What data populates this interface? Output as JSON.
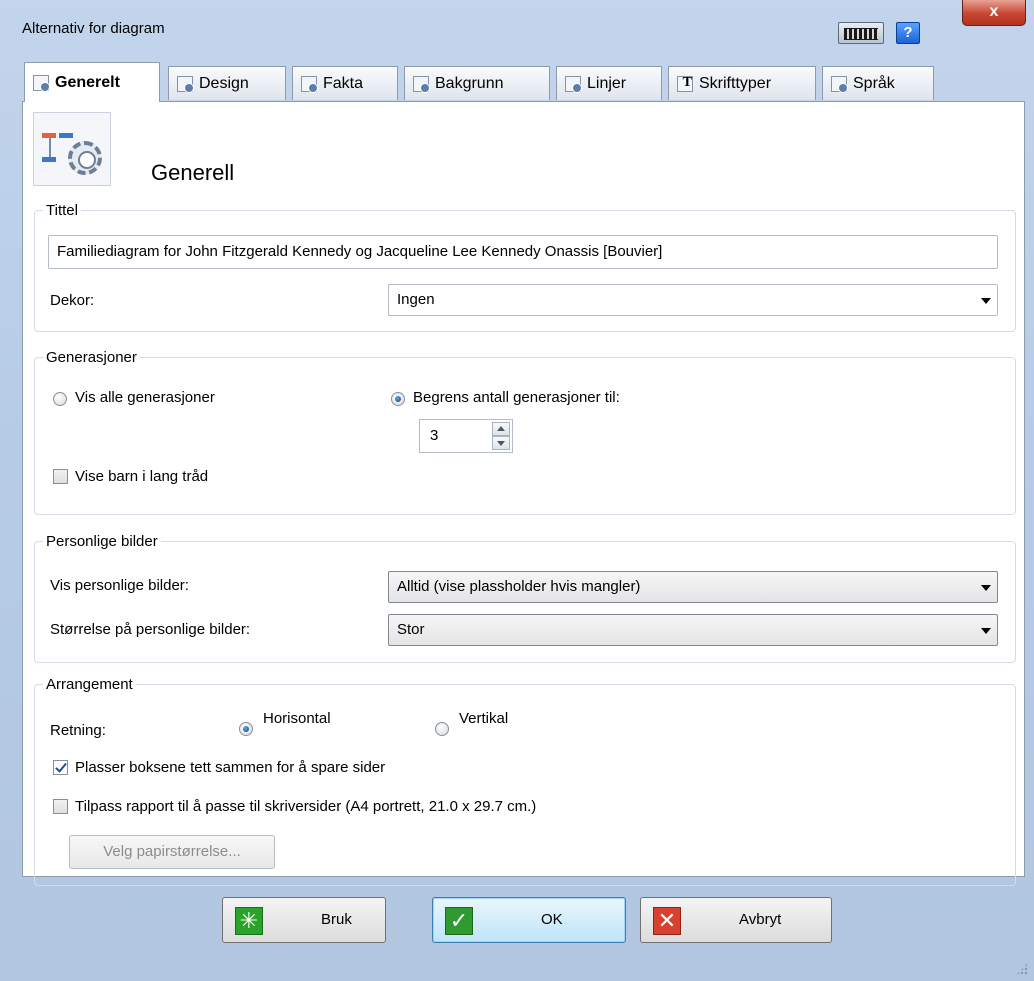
{
  "window": {
    "title": "Alternativ for diagram",
    "help_label": "?",
    "close_label": "x"
  },
  "tabs": [
    {
      "label": "Generelt",
      "active": true,
      "icon": "general-settings-icon"
    },
    {
      "label": "Design",
      "active": false,
      "icon": "design-preview-icon"
    },
    {
      "label": "Fakta",
      "active": false,
      "icon": "facts-icon"
    },
    {
      "label": "Bakgrunn",
      "active": false,
      "icon": "background-icon"
    },
    {
      "label": "Linjer",
      "active": false,
      "icon": "lines-icon"
    },
    {
      "label": "Skrifttyper",
      "active": false,
      "icon": "fonts-icon"
    },
    {
      "label": "Språk",
      "active": false,
      "icon": "language-icon"
    }
  ],
  "header": {
    "title": "Generell"
  },
  "tittel": {
    "legend": "Tittel",
    "value": "Familiediagram for John Fitzgerald Kennedy og Jacqueline Lee Kennedy Onassis [Bouvier]",
    "dekor_label": "Dekor:",
    "dekor_value": "Ingen"
  },
  "generasjoner": {
    "legend": "Generasjoner",
    "all_label": "Vis alle generasjoner",
    "all_selected": false,
    "limit_label": "Begrens antall generasjoner til:",
    "limit_selected": true,
    "limit_value": "3",
    "long_thread_label": "Vise barn i lang tråd",
    "long_thread_checked": false
  },
  "bilder": {
    "legend": "Personlige bilder",
    "show_label": "Vis personlige bilder:",
    "show_value": "Alltid (vise plassholder hvis mangler)",
    "size_label": "Størrelse på personlige bilder:",
    "size_value": "Stor"
  },
  "arrangement": {
    "legend": "Arrangement",
    "direction_label": "Retning:",
    "horizontal_label": "Horisontal",
    "horizontal_selected": true,
    "vertical_label": "Vertikal",
    "vertical_selected": false,
    "compact_label": "Plasser boksene tett sammen for å spare sider",
    "compact_checked": true,
    "fit_label": "Tilpass rapport til å passe til skriversider (A4 portrett, 21.0 x 29.7 cm.)",
    "fit_checked": false,
    "paper_button": "Velg papirstørrelse..."
  },
  "footer": {
    "apply": "Bruk",
    "ok": "OK",
    "cancel": "Avbryt"
  },
  "colors": {
    "window_frame": "#b6cbe6",
    "apply_icon": "#29a329",
    "ok_icon": "#2f9a2f",
    "cancel_icon": "#d8412f"
  }
}
